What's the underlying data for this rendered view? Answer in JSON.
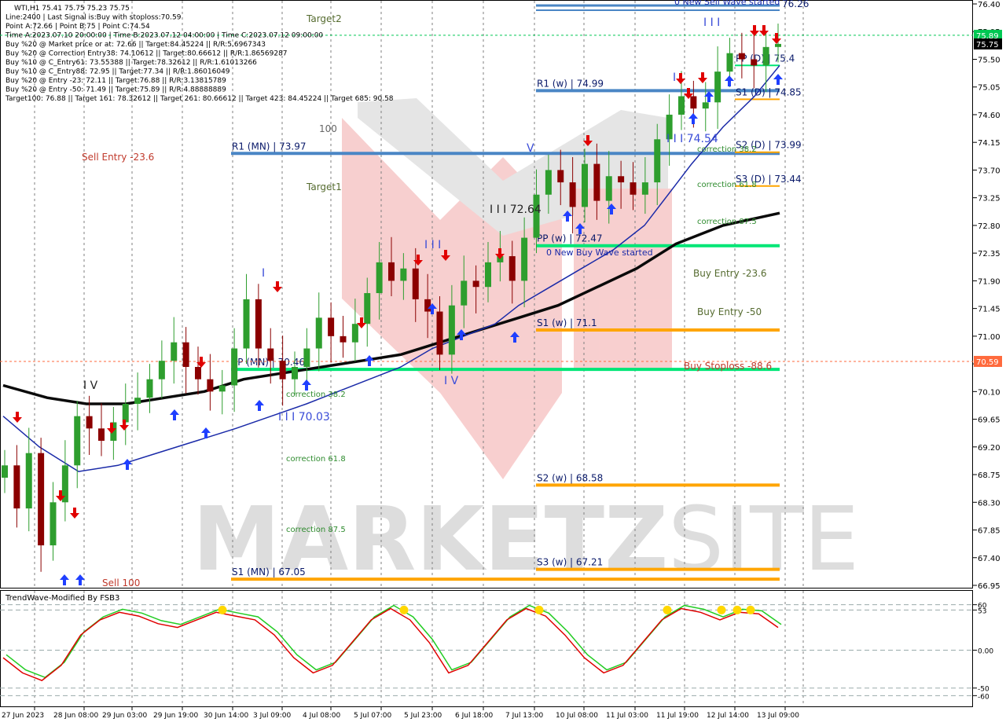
{
  "colors": {
    "background": "#ffffff",
    "grid": "#7f7f7f",
    "bull_candle": "#2e9e2e",
    "bear_candle": "#8b0000",
    "ma_fast": "#1a2aa8",
    "ma_slow": "#0a0a0a",
    "level_blue": "#4a86c5",
    "level_orange": "#ffa500",
    "level_green": "#00e676",
    "buy_arrow": "#1f3fff",
    "sell_arrow": "#e00000",
    "watermark_red": "#f2a8a8",
    "watermark_gray": "#d0d0d0",
    "osc_red": "#e00000",
    "osc_green": "#22cc22",
    "osc_dot": "#ffd700",
    "current_price_tag": "#000000",
    "stoploss_tag": "#ff6a3d",
    "target_tag": "#00c853"
  },
  "info_panel": {
    "lines": [
      "WTI,H1  75.41 75.75 75.23 75.75",
      "Line:2400 | Last Signal is:Buy with stoploss:70.59",
      "Point A:72.66 | Point B:75 | Point C:74.54",
      "Time A:2023.07.10 20:00:00 | Time B:2023.07.12 04:00:00 | Time C:2023.07.12 09:00:00",
      "Buy %20 @ Market price or at: 72.66 || Target:84.45224 || R/R:5.6967343",
      "Buy %20 @ Correction Entry38: 74.10612 || Target:80.66612 || R/R:1.86569287",
      "Buy %10 @ C_Entry61: 73.55388 || Target:78.32612 || R/R:1.61013266",
      "Buy %10 @ C_Entry88: 72.95 || Target:77.34 || R/R:1.86016049",
      "Buy %20 @ Entry -23: 72.11 || Target:76.88 || R/R:3.13815789",
      "Buy %20 @ Entry -50: 71.49 || Target:75.89 || R/R:4.88888889",
      "Target100: 76.88 || Target 161: 78.32612 || Target 261: 80.66612 || Target 423: 84.45224 || Target 685: 90.58"
    ]
  },
  "watermark": {
    "text": "MARKETZ",
    "text2": "SITE"
  },
  "price_axis": {
    "ticks": [
      "76.40",
      "75.95",
      "75.50",
      "75.05",
      "74.60",
      "74.15",
      "73.70",
      "73.25",
      "72.80",
      "72.35",
      "71.90",
      "71.45",
      "71.00",
      "70.55",
      "70.10",
      "69.65",
      "69.20",
      "68.75",
      "68.30",
      "67.85",
      "67.40",
      "66.95"
    ],
    "current_price": "75.75",
    "target_tag": "75.89",
    "stoploss_tag": "70.59"
  },
  "time_axis": {
    "labels": [
      "27 Jun 2023",
      "28 Jun 08:00",
      "29 Jun 03:00",
      "29 Jun 19:00",
      "30 Jun 14:00",
      "3 Jul 09:00",
      "4 Jul 08:00",
      "5 Jul 07:00",
      "5 Jul 23:00",
      "6 Jul 18:00",
      "7 Jul 13:00",
      "10 Jul 08:00",
      "11 Jul 03:00",
      "11 Jul 19:00",
      "12 Jul 14:00",
      "13 Jul 09:00"
    ]
  },
  "levels": [
    {
      "label": "R1 (MN) | 73.97",
      "price": 73.97,
      "color": "blue"
    },
    {
      "label": "R1 (w) | 74.99",
      "price": 74.99,
      "color": "blue"
    },
    {
      "label": "S1 (MN) | 67.05",
      "price": 67.05,
      "color": "orange"
    },
    {
      "label": "S3 (w) | 67.21",
      "price": 67.21,
      "color": "orange"
    },
    {
      "label": "S2 (w) | 68.58",
      "price": 68.58,
      "color": "orange"
    },
    {
      "label": "S1 (w) | 71.1",
      "price": 71.1,
      "color": "orange"
    },
    {
      "label": "PP (w) | 72.47",
      "price": 72.47,
      "color": "green"
    },
    {
      "label": "PP (MN) | 70.46",
      "price": 70.46,
      "color": "green"
    },
    {
      "label": "S2 (D) | 73.99",
      "price": 73.99,
      "color": "orange"
    },
    {
      "label": "S3 (D) | 73.44",
      "price": 73.44,
      "color": "orange"
    },
    {
      "label": "S1 (D) | 74.85",
      "price": 74.85,
      "color": "orange"
    },
    {
      "label": "PP (D) | 75.4",
      "price": 75.4,
      "color": "green"
    }
  ],
  "annotations": {
    "target2": "Target2",
    "target1": "Target1",
    "sell_entry": "Sell Entry -23.6",
    "sell_100": "Sell 100",
    "label_100": "100",
    "buy_entry_23": "Buy Entry -23.6",
    "buy_entry_50": "Buy Entry -50",
    "buy_stoploss": "Buy Stoploss -88.6",
    "new_buy_wave": "0 New Buy Wave started",
    "new_sell_wave": "0 New Sell Wave started",
    "correction_38": "correction 38.2",
    "correction_61": "correction 61.8",
    "correction_87": "correction 87.5",
    "correction_38_low": "correction 38.2",
    "correction_61_low": "correction 61.8",
    "correction_87_low": "correction 87.5",
    "wave_70": "I I I 70.03",
    "wave_7264": "I I I 72.64",
    "wave_7454": "I I I 74.54",
    "roman_iv": "I V",
    "roman_v": "V",
    "roman_i": "I",
    "roman_iii": "I I I",
    "roman_iv2": "I V",
    "top_right_value": "76.26"
  },
  "indicator": {
    "title": "TrendWave-Modified By FSB3",
    "ticks": [
      "60",
      "53",
      "0.00",
      "-50",
      "-60"
    ]
  },
  "chart_data": {
    "type": "candlestick",
    "title": "WTI,H1",
    "ylim": [
      66.95,
      76.4
    ],
    "price_series_close_approx": [
      68.9,
      68.2,
      69.1,
      67.6,
      68.3,
      68.9,
      69.7,
      69.5,
      69.3,
      69.6,
      69.9,
      70.0,
      70.3,
      70.6,
      70.9,
      70.5,
      70.3,
      70.1,
      70.2,
      70.8,
      71.6,
      70.8,
      70.6,
      70.3,
      70.5,
      70.8,
      71.3,
      71.0,
      70.9,
      71.2,
      71.7,
      72.2,
      71.9,
      72.1,
      71.6,
      71.4,
      70.7,
      71.5,
      71.9,
      71.8,
      72.2,
      72.3,
      71.9,
      72.6,
      73.3,
      73.7,
      73.5,
      73.1,
      73.8,
      73.2,
      73.6,
      73.5,
      73.3,
      73.5,
      74.2,
      74.6,
      74.9,
      74.7,
      74.8,
      75.3,
      75.6,
      75.5,
      75.4,
      75.7,
      75.75
    ],
    "ma_fast_approx": [
      69.7,
      69.2,
      68.8,
      68.9,
      69.1,
      69.3,
      69.5,
      69.7,
      69.9,
      70.1,
      70.3,
      70.5,
      70.8,
      71.0,
      71.2,
      71.5,
      71.8,
      72.1,
      72.4,
      72.8,
      73.3,
      73.8,
      74.4,
      74.9,
      75.4
    ],
    "ma_slow_approx": [
      70.2,
      70.0,
      69.9,
      69.9,
      70.0,
      70.1,
      70.3,
      70.4,
      70.5,
      70.6,
      70.7,
      70.9,
      71.1,
      71.3,
      71.5,
      71.8,
      72.1,
      72.5,
      72.8,
      73.0
    ],
    "oscillator_ylim": [
      -70,
      70
    ],
    "oscillator_red_approx": [
      -10,
      -30,
      -40,
      -20,
      20,
      40,
      50,
      45,
      35,
      30,
      40,
      50,
      45,
      40,
      20,
      -10,
      -30,
      -20,
      10,
      40,
      55,
      40,
      10,
      -30,
      -20,
      10,
      40,
      55,
      45,
      20,
      -10,
      -30,
      -20,
      10,
      40,
      55,
      50,
      40,
      50,
      48,
      30
    ]
  }
}
